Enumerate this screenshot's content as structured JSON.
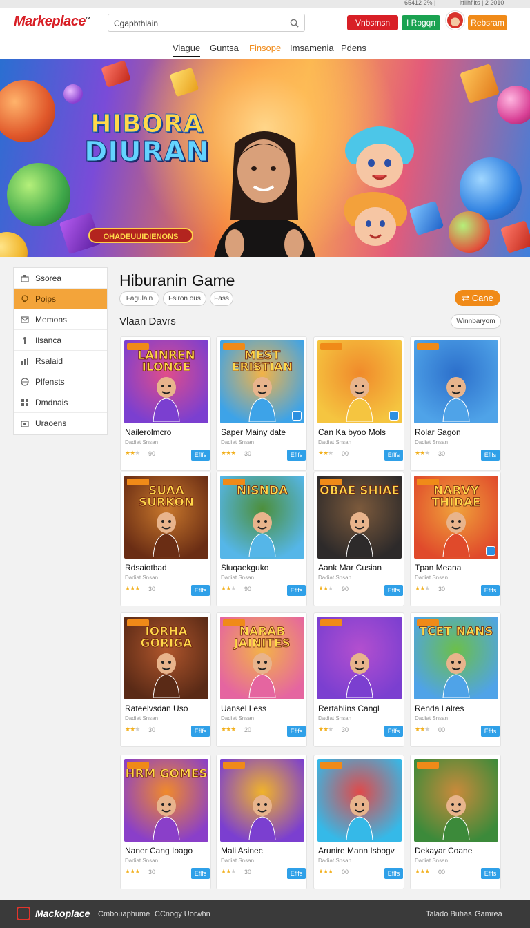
{
  "utility": {
    "left_text": "65412 2% | ",
    "right_text": "itflihflits | 2 2010"
  },
  "header": {
    "logo": {
      "first": "Markeplace",
      "rest": "",
      "mark": "™"
    },
    "search": {
      "value": "Cgapbthlain",
      "placeholder": "Cgapbthlain",
      "icon": "search-icon"
    },
    "buttons": {
      "red": "Vnbsmsn",
      "green": "I Rogqn",
      "orange": "Rebsram"
    },
    "avatar": "avatar"
  },
  "nav": {
    "tabs": [
      {
        "label": "Viague",
        "active": true
      },
      {
        "label": "Guntsa"
      },
      {
        "label": "Finsope",
        "highlight": true
      },
      {
        "label": "Imsamenia"
      },
      {
        "label": "Pdens"
      }
    ]
  },
  "hero": {
    "title_line1": "HIBORA",
    "title_line2": "DIURAN",
    "subtitle": "OHADEUUIDIENONS"
  },
  "sidebar": {
    "items": [
      {
        "label": "Ssorea",
        "icon": "store-icon"
      },
      {
        "label": "Poips",
        "icon": "bulb-icon",
        "active": true
      },
      {
        "label": "Memons",
        "icon": "mail-icon"
      },
      {
        "label": "Ilsanca",
        "icon": "figure-icon"
      },
      {
        "label": "Rsalaid",
        "icon": "chart-icon"
      },
      {
        "label": "Plfensts",
        "icon": "globe-icon"
      },
      {
        "label": "Dmdnais",
        "icon": "grid-icon"
      },
      {
        "label": "Uraoens",
        "icon": "camera-icon"
      }
    ]
  },
  "main": {
    "title": "Hiburanin Game",
    "chips": [
      "Fagulain",
      "Fsiron ous",
      "Fass"
    ],
    "cta": "Cane",
    "section_title": "Vlaan Davrs",
    "sort_label": "Winnbaryom"
  },
  "cards": [
    {
      "name": "Nailerolmcro",
      "sub": "Dadiat Snsan",
      "stars": 2,
      "rating": "90",
      "buy": "Eflfs",
      "word": "LAINREN ILONGE",
      "color1": "#7b3fd0",
      "color2": "#e04d8a"
    },
    {
      "name": "Saper Mainy date",
      "sub": "Dadiat Snsan",
      "stars": 3,
      "rating": "30",
      "buy": "Eflfs",
      "word": "MEST ERISTIAN",
      "color1": "#3da3e8",
      "color2": "#f3b347",
      "mark": true
    },
    {
      "name": "Can Ka byoo Mols",
      "sub": "Dadiat Snsan",
      "stars": 2,
      "rating": "00",
      "buy": "Eflfs",
      "word": "",
      "color1": "#f5c540",
      "color2": "#f08a2b",
      "mark": true
    },
    {
      "name": "Rolar Sagon",
      "sub": "Dadiat Snsan",
      "stars": 2,
      "rating": "30",
      "buy": "Eflfs",
      "word": "",
      "color1": "#4fa3e8",
      "color2": "#2c6fcb"
    },
    {
      "name": "Rdsaiotbad",
      "sub": "Dadiat Snsan",
      "stars": 3,
      "rating": "30",
      "buy": "Eflfs",
      "word": "SUAA SURKON",
      "color1": "#6a2d14",
      "color2": "#c9782c"
    },
    {
      "name": "Sluqaekguko",
      "sub": "Dadiat Snsan",
      "stars": 2,
      "rating": "90",
      "buy": "Eflfs",
      "word": "NISNDA",
      "color1": "#55b6e8",
      "color2": "#4d8f3b"
    },
    {
      "name": "Aank Mar Cusian",
      "sub": "Dadiat Snsan",
      "stars": 2,
      "rating": "90",
      "buy": "Eflfs",
      "word": "OBAE SHIAE",
      "color1": "#2d2a2a",
      "color2": "#7c5a3c"
    },
    {
      "name": "Tpan Meana",
      "sub": "Dadiat Snsan",
      "stars": 2,
      "rating": "30",
      "buy": "Eflfs",
      "word": "NARVY THIDAE",
      "color1": "#e04a2b",
      "color2": "#f0a33b",
      "mark": true
    },
    {
      "name": "Rateelvsdan Uso",
      "sub": "Dadiat Snsan",
      "stars": 2,
      "rating": "30",
      "buy": "Eflfs",
      "word": "IORHA GORIGA",
      "color1": "#5a2a16",
      "color2": "#b0562c"
    },
    {
      "name": "Uansel Less",
      "sub": "Dadiat Snsan",
      "stars": 3,
      "rating": "20",
      "buy": "Eflfs",
      "word": "NARAB JAINITES",
      "color1": "#e565a0",
      "color2": "#f3b347"
    },
    {
      "name": "Rertablins Cangl",
      "sub": "Dadiat Snsan",
      "stars": 2,
      "rating": "30",
      "buy": "Eflfs",
      "word": "",
      "color1": "#7b3fd0",
      "color2": "#b34fcf"
    },
    {
      "name": "Renda Lalres",
      "sub": "Dadiat Snsan",
      "stars": 2,
      "rating": "00",
      "buy": "Eflfs",
      "word": "TCET NANS",
      "color1": "#4fa3e8",
      "color2": "#6cbf4a"
    },
    {
      "name": "Naner Cang Ioago",
      "sub": "Dadiat Snsan",
      "stars": 3,
      "rating": "30",
      "buy": "Eflfs",
      "word": "HRM GOMES",
      "color1": "#8a3fc9",
      "color2": "#f08a2b"
    },
    {
      "name": "Mali Asinec",
      "sub": "Dadiat Snsan",
      "stars": 2,
      "rating": "30",
      "buy": "Eflfs",
      "word": "",
      "color1": "#7b3fd0",
      "color2": "#f0b32b"
    },
    {
      "name": "Arunire Mann Isbogv",
      "sub": "Dadiat Snsan",
      "stars": 3,
      "rating": "00",
      "buy": "Eflfs",
      "word": "",
      "color1": "#35b9e8",
      "color2": "#e04a4a"
    },
    {
      "name": "Dekayar Coane",
      "sub": "Dadiat Snsan",
      "stars": 3,
      "rating": "00",
      "buy": "Eflfs",
      "word": "",
      "color1": "#3c8a3a",
      "color2": "#c98a3b"
    }
  ],
  "footer": {
    "logo": "Mackoplace",
    "links": [
      "Cmbouaphume",
      "CCnogy Uorwhn"
    ],
    "right_links": [
      "Talado Buhas",
      "Gamrea"
    ]
  }
}
